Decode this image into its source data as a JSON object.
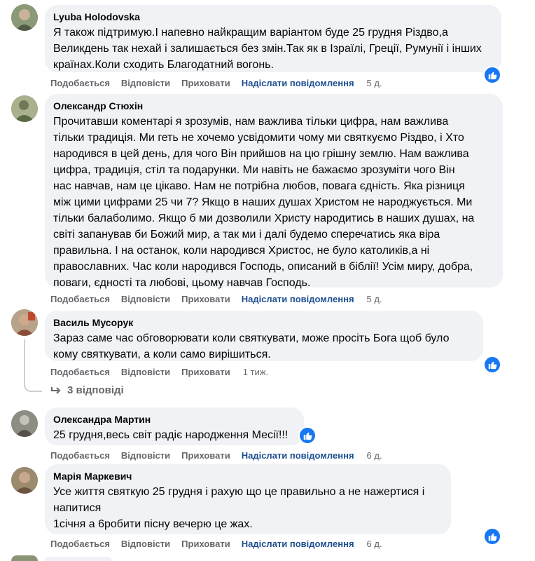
{
  "comments": [
    {
      "author": "Lyuba Holodovska",
      "text": "Я також підтримую.І напевно найкращим варіантом буде 25 грудня Різдво,а\nВеликдень так нехай і залишається без змін.Так як в Ізраїлі, Греції, Румунії і інших\nкраїнах.Коли сходить Благодатний вогонь.",
      "like_label": "Подобається",
      "reply_label": "Відповісти",
      "hide_label": "Приховати",
      "send_label": "Надіслати повідомлення",
      "time": "5 д."
    },
    {
      "author": "Олександр Стюхін",
      "text": "Прочитавши коментарі я зрозумів, нам важлива тільки цифра, нам важлива\nтільки традиція. Ми геть не хочемо усвідомити чому ми святкуємо Різдво, і Хто\nнародився в цей день, для чого Він прийшов на цю грішну землю. Нам важлива\nцифра, традиція, стіл та подарунки. Ми навіть не бажаємо зрозуміти чого Він\nнас навчав, нам це цікаво. Нам не потрібна любов, повага єдність. Яка різниця\nміж цими цифрами 25 чи 7? Якщо в наших душах Христом не народжується. Ми\nтільки балаболимо. Якщо б ми дозволили Христу народитись в наших душах, на\nсвіті запанував би Божий мир, а так ми і далі будемо сперечатись яка віра\nправильна. І на останок, коли народився Христос, не було католиків,а ні\nправославних. Час коли народився Господь, описаний в біблії! Усім миру, добра,\nповаги, єдності та любові, цьому навчав Господь.",
      "like_label": "Подобається",
      "reply_label": "Відповісти",
      "hide_label": "Приховати",
      "send_label": "Надіслати повідомлення",
      "time": "5 д."
    },
    {
      "author": "Василь Мусорук",
      "text": "Зараз саме час обговорювати коли святкувати, може просіть Бога щоб було\nкому святкувати, а коли само вирішиться.",
      "like_label": "Подобається",
      "reply_label": "Відповісти",
      "hide_label": "Приховати",
      "time": "1 тиж.",
      "replies_label": "3 відповіді"
    },
    {
      "author": "Олександра Мартин",
      "text": "25 грудня,весь світ радіє народження Месії!!!",
      "like_label": "Подобається",
      "reply_label": "Відповісти",
      "hide_label": "Приховати",
      "send_label": "Надіслати повідомлення",
      "time": "6 д."
    },
    {
      "author": "Марія Маркевич",
      "text": "Усе життя святкую 25 грудня і рахую що це правильно а не нажертися і\nнапитися\n1січня а 6робити пісну вечерю це жах.",
      "like_label": "Подобається",
      "reply_label": "Відповісти",
      "hide_label": "Приховати",
      "send_label": "Надіслати повідомлення",
      "time": "6 д."
    }
  ],
  "colors": {
    "bubble": "#f0f2f5",
    "like_blue": "#1877f2",
    "action_gray": "#65676b",
    "send_blue": "#1d4f91"
  }
}
